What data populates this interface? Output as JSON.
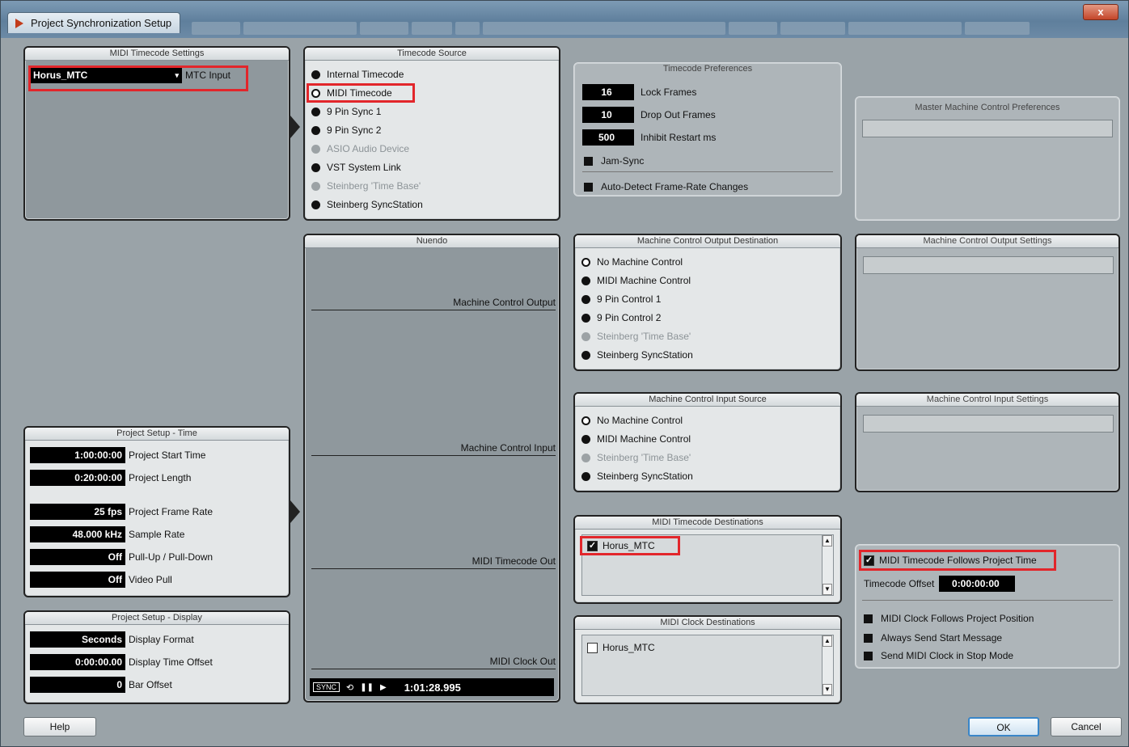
{
  "window": {
    "title": "Project Synchronization Setup",
    "close_label": "x"
  },
  "midi_tc_settings": {
    "title": "MIDI Timecode Settings",
    "input_value": "Horus_MTC",
    "input_label": "MTC Input"
  },
  "timecode_source": {
    "title": "Timecode Source",
    "items": [
      {
        "label": "Internal Timecode",
        "state": "filled"
      },
      {
        "label": "MIDI Timecode",
        "state": "selected"
      },
      {
        "label": "9 Pin Sync 1",
        "state": "filled"
      },
      {
        "label": "9 Pin Sync 2",
        "state": "filled"
      },
      {
        "label": "ASIO Audio Device",
        "state": "disabled"
      },
      {
        "label": "VST System Link",
        "state": "filled"
      },
      {
        "label": "Steinberg 'Time Base'",
        "state": "disabled"
      },
      {
        "label": "Steinberg SyncStation",
        "state": "filled"
      }
    ]
  },
  "timecode_prefs": {
    "title": "Timecode Preferences",
    "lock_frames": {
      "value": "16",
      "label": "Lock Frames"
    },
    "drop_out_frames": {
      "value": "10",
      "label": "Drop Out Frames"
    },
    "inhibit_restart": {
      "value": "500",
      "label": "Inhibit Restart ms"
    },
    "jam_sync": "Jam-Sync",
    "auto_detect": "Auto-Detect Frame-Rate Changes"
  },
  "master_mc_prefs": {
    "title": "Master Machine Control Preferences"
  },
  "nuendo": {
    "title": "Nuendo",
    "labels": {
      "mc_output": "Machine Control Output",
      "mc_input": "Machine Control Input",
      "mtc_out": "MIDI Timecode Out",
      "clock_out": "MIDI Clock Out"
    },
    "transport": {
      "sync": "SYNC",
      "time": "1:01:28.995"
    }
  },
  "mc_output_dest": {
    "title": "Machine Control Output Destination",
    "items": [
      {
        "label": "No Machine Control",
        "state": "selected"
      },
      {
        "label": "MIDI Machine Control",
        "state": "filled"
      },
      {
        "label": "9 Pin Control 1",
        "state": "filled"
      },
      {
        "label": "9 Pin Control 2",
        "state": "filled"
      },
      {
        "label": "Steinberg 'Time Base'",
        "state": "disabled"
      },
      {
        "label": "Steinberg SyncStation",
        "state": "filled"
      }
    ]
  },
  "mc_output_settings": {
    "title": "Machine Control Output Settings"
  },
  "mc_input_source": {
    "title": "Machine Control Input Source",
    "items": [
      {
        "label": "No Machine Control",
        "state": "selected"
      },
      {
        "label": "MIDI Machine Control",
        "state": "filled"
      },
      {
        "label": "Steinberg 'Time Base'",
        "state": "disabled"
      },
      {
        "label": "Steinberg SyncStation",
        "state": "filled"
      }
    ]
  },
  "mc_input_settings": {
    "title": "Machine Control Input Settings"
  },
  "mtc_destinations": {
    "title": "MIDI Timecode Destinations",
    "item": "Horus_MTC",
    "checked": true
  },
  "clock_destinations": {
    "title": "MIDI Clock Destinations",
    "item": "Horus_MTC",
    "checked": false
  },
  "mtc_follow": {
    "follows_label": "MIDI Timecode Follows Project Time",
    "offset_label": "Timecode Offset",
    "offset_value": "0:00:00:00",
    "clock_follows": "MIDI Clock Follows Project Position",
    "always_start": "Always Send Start Message",
    "stop_mode": "Send MIDI Clock in Stop Mode"
  },
  "project_time": {
    "title": "Project Setup - Time",
    "rows": [
      {
        "value": "1:00:00:00",
        "label": "Project Start Time"
      },
      {
        "value": "0:20:00:00",
        "label": "Project Length"
      },
      {
        "value": "25 fps",
        "label": "Project Frame Rate"
      },
      {
        "value": "48.000 kHz",
        "label": "Sample Rate"
      },
      {
        "value": "Off",
        "label": "Pull-Up / Pull-Down"
      },
      {
        "value": "Off",
        "label": "Video Pull"
      }
    ]
  },
  "project_display": {
    "title": "Project Setup - Display",
    "rows": [
      {
        "value": "Seconds",
        "label": "Display Format"
      },
      {
        "value": "0:00:00.00",
        "label": "Display Time Offset"
      },
      {
        "value": "0",
        "label": "Bar Offset"
      }
    ]
  },
  "buttons": {
    "help": "Help",
    "ok": "OK",
    "cancel": "Cancel"
  }
}
